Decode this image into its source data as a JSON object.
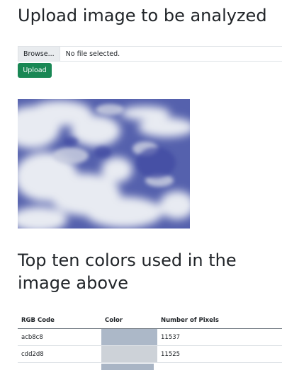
{
  "header": {
    "title": "Upload image to be analyzed"
  },
  "upload_form": {
    "browse_label": "Browse...",
    "file_status": "No file selected.",
    "upload_label": "Upload"
  },
  "image": {
    "subject": "blue sky with white clouds"
  },
  "results": {
    "title": "Top ten colors used in the image above",
    "columns": [
      "RGB Code",
      "Color",
      "Number of Pixels"
    ],
    "rows": [
      {
        "rgb": "acb8c8",
        "color": "#acb8c8",
        "pixels": "11537"
      },
      {
        "rgb": "cdd2d8",
        "color": "#cdd2d8",
        "pixels": "11525"
      }
    ],
    "partial_row_color": "#a9b5c5"
  },
  "colors": {
    "primary_button": "#198754",
    "text": "#212529"
  }
}
